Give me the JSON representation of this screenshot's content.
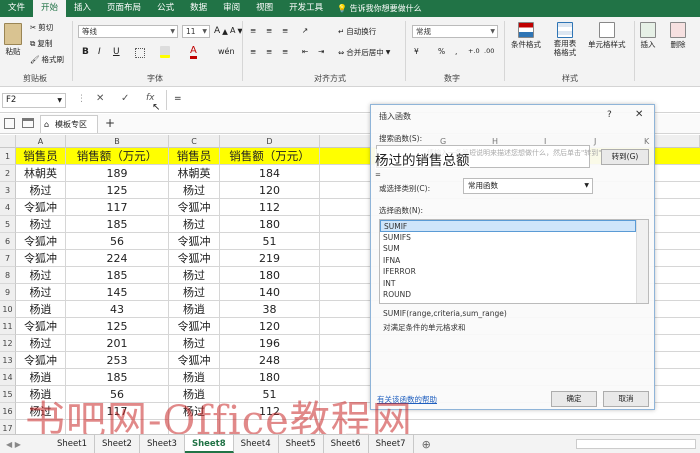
{
  "ribbon_tabs": [
    "文件",
    "开始",
    "插入",
    "页面布局",
    "公式",
    "数据",
    "审阅",
    "视图",
    "开发工具"
  ],
  "tell_me": "告诉我你想要做什么",
  "clipboard": {
    "paste": "粘贴",
    "cut": "剪切",
    "copy": "复制",
    "format_painter": "格式刷",
    "label": "剪贴板"
  },
  "font": {
    "name": "等线",
    "size": "11",
    "label": "字体",
    "bold": "B",
    "italic": "I",
    "underline": "U",
    "grow": "A",
    "shrink": "A",
    "wen": "wén"
  },
  "alignment": {
    "wrap": "自动换行",
    "merge": "合并后居中",
    "label": "对齐方式"
  },
  "number": {
    "format": "常规",
    "label": "数字",
    "currency": "¥",
    "percent": "%",
    "comma": ","
  },
  "styles": {
    "conditional": "条件格式",
    "table": "套用表格格式",
    "cell": "单元格样式",
    "label": "样式"
  },
  "cells": {
    "insert": "插入",
    "delete": "删除"
  },
  "formula_bar": {
    "name_box": "F2",
    "cancel": "✕",
    "enter": "✓",
    "fx": "fx",
    "content": "="
  },
  "workbook": {
    "template_tab": "模板专区",
    "add": "+"
  },
  "columns": [
    "A",
    "B",
    "C",
    "D",
    "E"
  ],
  "col_letters_under_dialog": [
    "G",
    "H",
    "I",
    "J",
    "K"
  ],
  "rows": [
    {
      "n": "1",
      "a": "销售员",
      "b": "销售额（万元）",
      "c": "销售员",
      "d": "销售额（万元）"
    },
    {
      "n": "2",
      "a": "林朝英",
      "b": "189",
      "c": "林朝英",
      "d": "184"
    },
    {
      "n": "3",
      "a": "杨过",
      "b": "125",
      "c": "杨过",
      "d": "120"
    },
    {
      "n": "4",
      "a": "令狐冲",
      "b": "117",
      "c": "令狐冲",
      "d": "112"
    },
    {
      "n": "5",
      "a": "杨过",
      "b": "185",
      "c": "杨过",
      "d": "180"
    },
    {
      "n": "6",
      "a": "令狐冲",
      "b": "56",
      "c": "令狐冲",
      "d": "51"
    },
    {
      "n": "7",
      "a": "令狐冲",
      "b": "224",
      "c": "令狐冲",
      "d": "219"
    },
    {
      "n": "8",
      "a": "杨过",
      "b": "185",
      "c": "杨过",
      "d": "180"
    },
    {
      "n": "9",
      "a": "杨过",
      "b": "145",
      "c": "杨过",
      "d": "140"
    },
    {
      "n": "10",
      "a": "杨逍",
      "b": "43",
      "c": "杨逍",
      "d": "38"
    },
    {
      "n": "11",
      "a": "令狐冲",
      "b": "125",
      "c": "令狐冲",
      "d": "120"
    },
    {
      "n": "12",
      "a": "杨过",
      "b": "201",
      "c": "杨过",
      "d": "196"
    },
    {
      "n": "13",
      "a": "令狐冲",
      "b": "253",
      "c": "令狐冲",
      "d": "248"
    },
    {
      "n": "14",
      "a": "杨逍",
      "b": "185",
      "c": "杨逍",
      "d": "180"
    },
    {
      "n": "15",
      "a": "杨逍",
      "b": "56",
      "c": "杨逍",
      "d": "51"
    },
    {
      "n": "16",
      "a": "杨过",
      "b": "117",
      "c": "杨过",
      "d": "112"
    },
    {
      "n": "17",
      "a": "",
      "b": "",
      "c": "",
      "d": ""
    }
  ],
  "dialog": {
    "title": "插入函数",
    "help": "?",
    "close": "✕",
    "search_label": "搜索函数(S):",
    "search_value": "杨过的销售总额",
    "search_hint": "请输入一条简短说明来描述您想做什么，然后单击\"转到\"",
    "go_button": "转到(G)",
    "category_label": "或选择类别(C):",
    "category_value": "常用函数",
    "select_label": "选择函数(N):",
    "functions": [
      "SUMIF",
      "SUMIFS",
      "SUM",
      "IFNA",
      "IFERROR",
      "INT",
      "ROUND"
    ],
    "signature": "SUMIF(range,criteria,sum_range)",
    "description": "对满足条件的单元格求和",
    "help_link": "有关该函数的帮助",
    "ok": "确定",
    "cancel": "取消",
    "cell_ref": "="
  },
  "sheets": [
    "Sheet1",
    "Sheet2",
    "Sheet3",
    "Sheet8",
    "Sheet4",
    "Sheet5",
    "Sheet6",
    "Sheet7"
  ],
  "active_sheet": "Sheet8",
  "add_sheet": "⊕",
  "watermark": "书吧网-Office教程网",
  "colors": {
    "excel_green": "#217346",
    "header_fill": "#ffff00",
    "dialog_border": "#8fb4d8",
    "selection": "#cfe5fa"
  }
}
